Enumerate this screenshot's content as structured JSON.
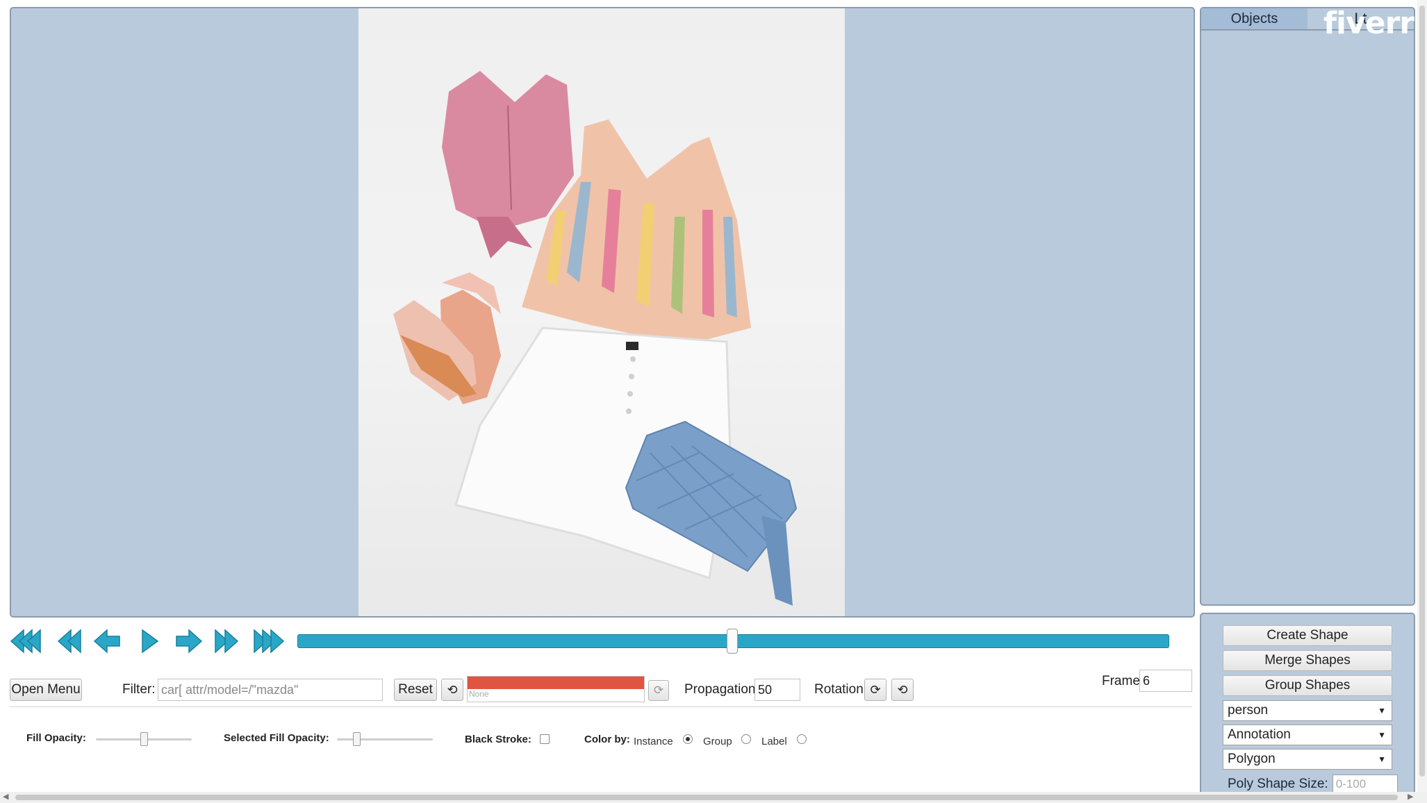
{
  "side_panel": {
    "tabs": [
      {
        "label": "Objects"
      },
      {
        "label": "Lt"
      }
    ],
    "watermark": "fiverr"
  },
  "controls": {
    "create_shape": "Create Shape",
    "merge_shapes": "Merge Shapes",
    "group_shapes": "Group Shapes",
    "label_select": "person",
    "mode_select": "Annotation",
    "shape_select": "Polygon",
    "poly_size_label": "Poly Shape Size:",
    "poly_size_placeholder": "0-100"
  },
  "player": {
    "timeline_position": 0.4986
  },
  "toolbar": {
    "open_menu": "Open Menu",
    "filter_label": "Filter:",
    "filter_value": "car[ attr/model=/\"mazda\"",
    "reset": "Reset",
    "label_color_none": "None",
    "label_color_hex": "#e05442",
    "propagation_label": "Propagation",
    "propagation_value": "50",
    "rotation_label": "Rotation",
    "frame_label": "Frame",
    "frame_value": "6"
  },
  "appearance": {
    "fill_opacity_label": "Fill Opacity:",
    "fill_opacity": 0.5,
    "selected_fill_opacity_label": "Selected Fill Opacity:",
    "selected_fill_opacity": 0.2,
    "black_stroke_label": "Black Stroke:",
    "color_by_label": "Color by:",
    "color_by_options": [
      "Instance",
      "Group",
      "Label"
    ],
    "color_by_selected": "Instance"
  },
  "colors": {
    "canvas_bg": "#b9cadc",
    "timeline": "#2aa7c7",
    "player_icons": "#2aa7c7"
  },
  "icons": {
    "first": "first-frame-icon",
    "prev_step": "step-back-icon",
    "prev": "prev-frame-icon",
    "play": "play-icon",
    "next": "next-frame-icon",
    "next_step": "step-forward-icon",
    "last": "last-frame-icon",
    "reset_filter": "undo-icon",
    "propagate": "refresh-icon",
    "rotate_cw": "rotate-clockwise-icon",
    "rotate_ccw": "rotate-counterclockwise-icon"
  }
}
